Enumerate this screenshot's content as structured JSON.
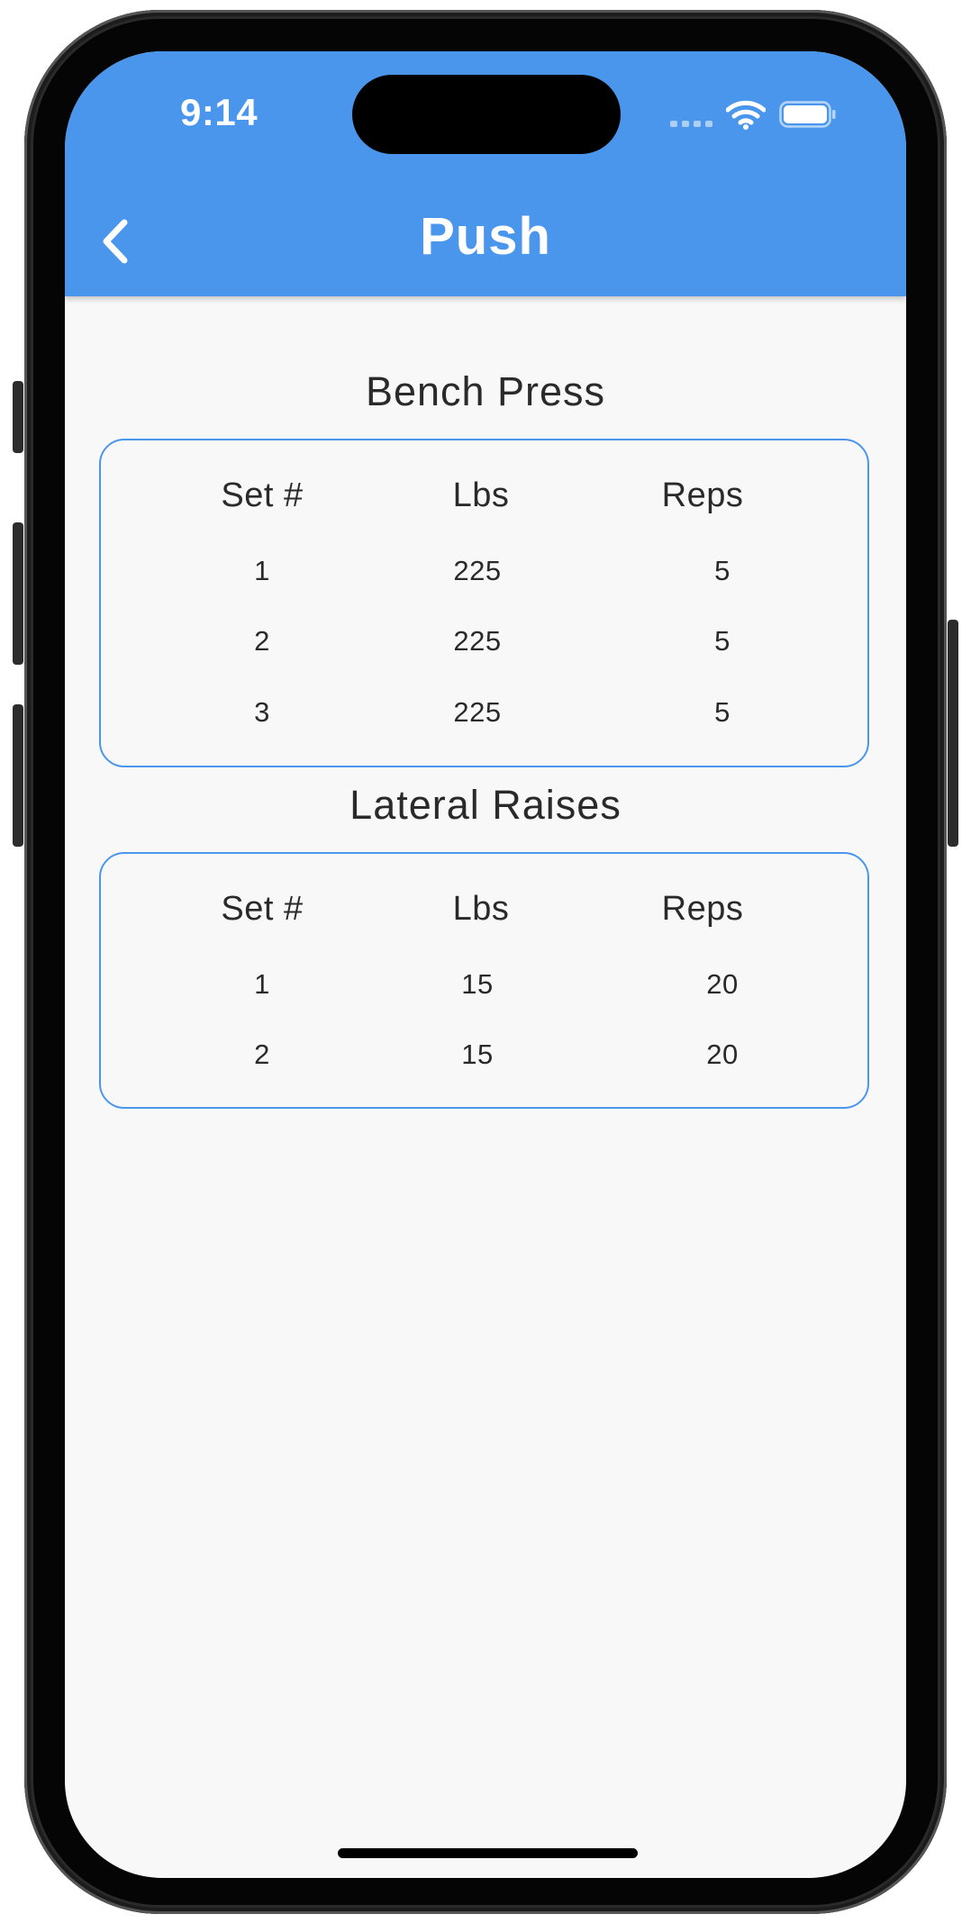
{
  "status_bar": {
    "time": "9:14"
  },
  "header": {
    "title": "Push",
    "back_icon": "chevron-left-icon"
  },
  "colors": {
    "header": "#4a96ec",
    "card_border": "#4a96ec",
    "background": "#f8f8f8",
    "text": "#2a2a2a"
  },
  "columns": [
    "Set #",
    "Lbs",
    "Reps"
  ],
  "exercises": [
    {
      "name": "Bench Press",
      "sets": [
        {
          "set": "1",
          "lbs": "225",
          "reps": "5"
        },
        {
          "set": "2",
          "lbs": "225",
          "reps": "5"
        },
        {
          "set": "3",
          "lbs": "225",
          "reps": "5"
        }
      ]
    },
    {
      "name": "Lateral Raises",
      "sets": [
        {
          "set": "1",
          "lbs": "15",
          "reps": "20"
        },
        {
          "set": "2",
          "lbs": "15",
          "reps": "20"
        }
      ]
    }
  ]
}
